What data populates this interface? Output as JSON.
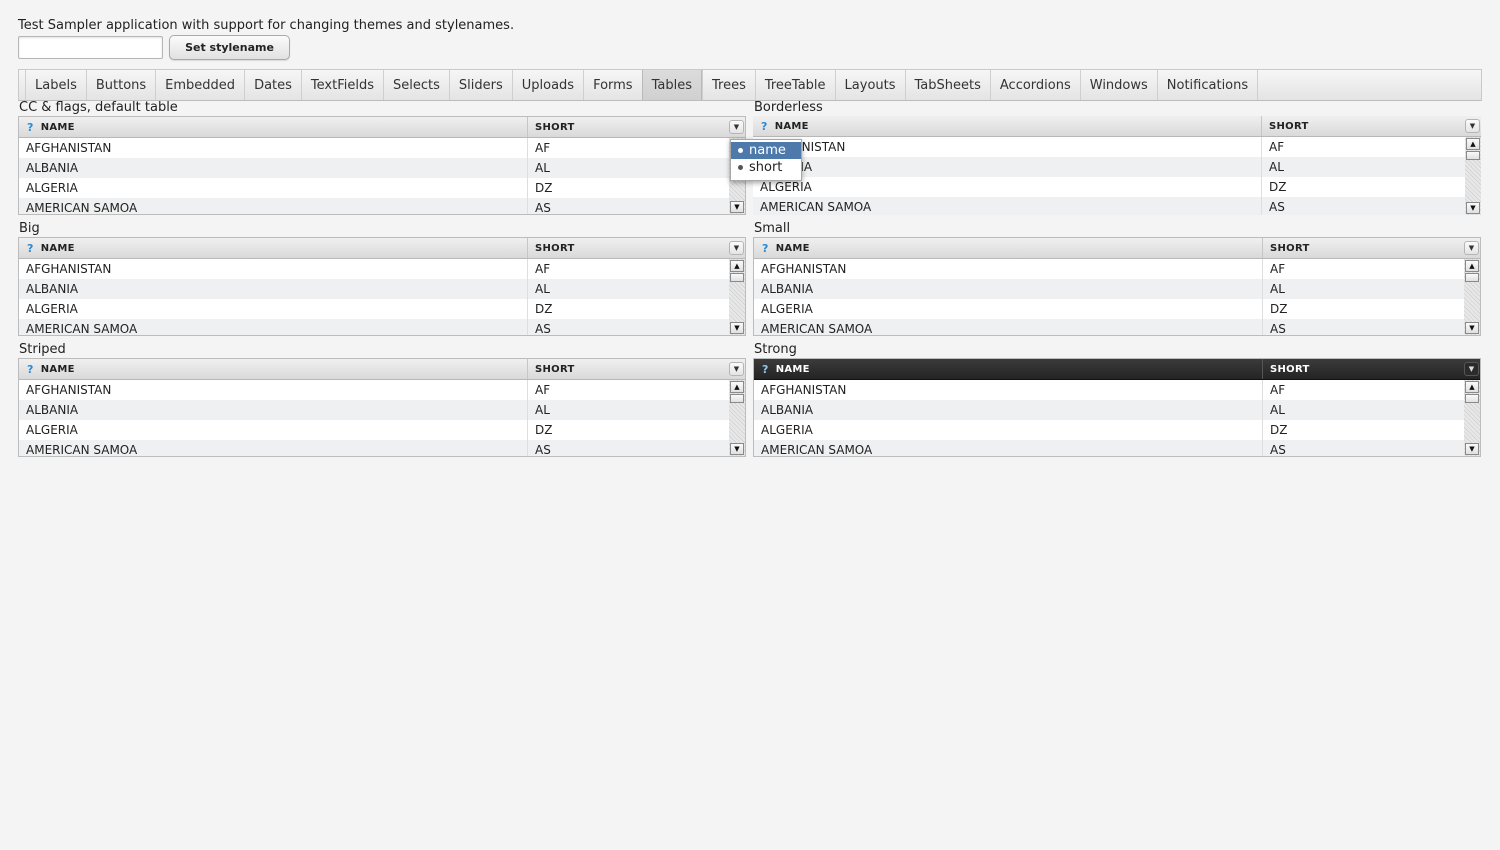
{
  "intro_text": "Test Sampler application with support for changing themes and stylenames.",
  "stylename": {
    "value": "",
    "button_label": "Set stylename"
  },
  "tabs": [
    {
      "label": "Labels"
    },
    {
      "label": "Buttons"
    },
    {
      "label": "Embedded"
    },
    {
      "label": "Dates"
    },
    {
      "label": "TextFields"
    },
    {
      "label": "Selects"
    },
    {
      "label": "Sliders"
    },
    {
      "label": "Uploads"
    },
    {
      "label": "Forms"
    },
    {
      "label": "Tables",
      "selected": true
    },
    {
      "label": "Trees"
    },
    {
      "label": "TreeTable"
    },
    {
      "label": "Layouts"
    },
    {
      "label": "TabSheets"
    },
    {
      "label": "Accordions"
    },
    {
      "label": "Windows"
    },
    {
      "label": "Notifications"
    }
  ],
  "tables": {
    "t1": {
      "caption": "CC & flags, default table"
    },
    "t2": {
      "caption": "Borderless"
    },
    "t3": {
      "caption": "Big"
    },
    "t4": {
      "caption": "Small"
    },
    "t5": {
      "caption": "Striped"
    },
    "t6": {
      "caption": "Strong"
    }
  },
  "columns": {
    "name": "NAME",
    "short": "SHORT",
    "help_icon": "question-icon"
  },
  "rows": [
    {
      "name": "AFGHANISTAN",
      "short": "AF"
    },
    {
      "name": "ALBANIA",
      "short": "AL"
    },
    {
      "name": "ALGERIA",
      "short": "DZ"
    },
    {
      "name": "AMERICAN SAMOA",
      "short": "AS"
    }
  ],
  "column_popup": {
    "items": [
      "name",
      "short"
    ]
  },
  "colors": {
    "selected_menu_item": "#4d7aaa",
    "strong_header": "#2b2b2b",
    "help_icon": "#2a8bd6"
  }
}
